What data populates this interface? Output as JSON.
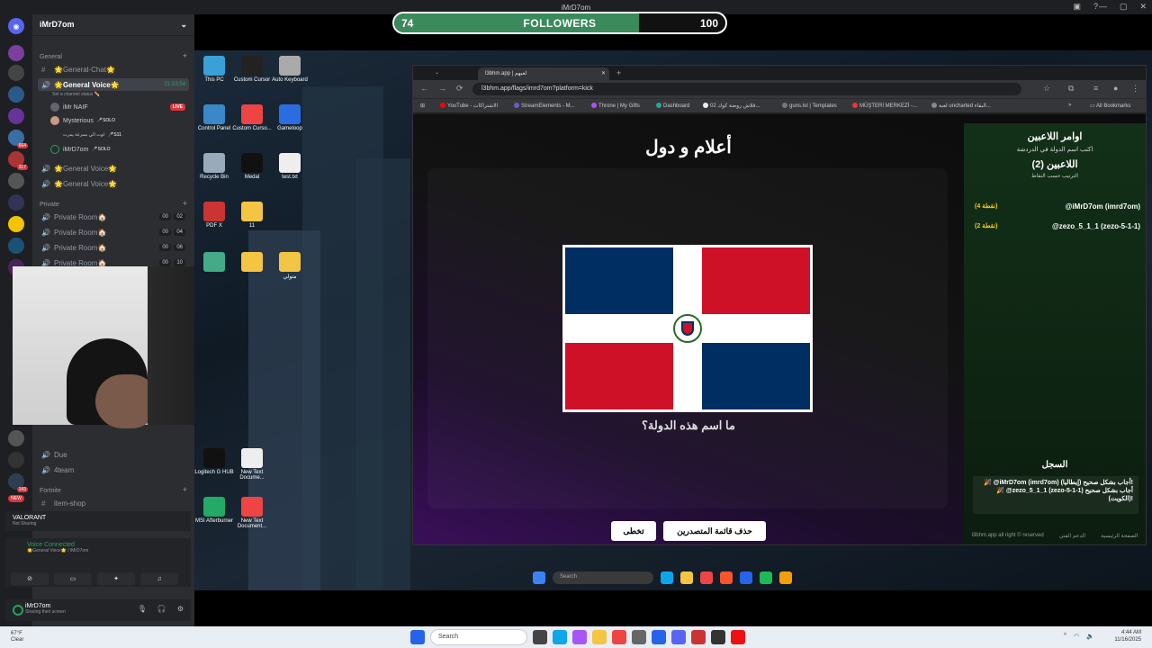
{
  "window": {
    "title": "iMrD7om"
  },
  "followers": {
    "current": "74",
    "label": "FOLLOWERS",
    "goal": "100",
    "progress": 0.74
  },
  "discord": {
    "server_name": "iMrD7om",
    "server_badges": [
      "664",
      "317",
      "24",
      "143",
      "NEW"
    ],
    "category_general": "General",
    "category_private": "Private",
    "category_fortnite": "Fortnite",
    "channels": {
      "general_chat": "🌟General-Chat🌟",
      "general_voice": "🌟General Voice🌟",
      "general_voice_time": "21:53:54",
      "set_status": "Set a channel status ✏️",
      "voice2": "🌟General Voice🌟",
      "voice3": "🌟General Voice🌟",
      "private1": "Private Room🏠",
      "private2": "Private Room🏠",
      "private3": "Private Room🏠",
      "private4": "Private Room🏠",
      "p1_a": "00",
      "p1_b": "02",
      "p2_a": "00",
      "p2_b": "04",
      "p3_a": "00",
      "p3_b": "06",
      "p4_a": "00",
      "p4_b": "10",
      "due": "Due",
      "team": "4team",
      "item_shop": "item-shop"
    },
    "voice_users": [
      {
        "name": "iMr NAIF",
        "tag": ""
      },
      {
        "name": "Mysterious",
        "tag": "🎤SOLO"
      },
      {
        "name": "لوت الي بسرعة يمرت",
        "tag": "🎤S11"
      },
      {
        "name": "iMrD7om",
        "tag": "🎤SOLO"
      }
    ],
    "live_badge": "LIVE",
    "activity": {
      "game": "VALORANT",
      "detail": "Not Sharing"
    },
    "voice_connected": {
      "title": "Voice Connected",
      "channel": "🌟General Voice🌟 / iMrD7om"
    },
    "user": {
      "name": "iMrD7om",
      "status": "Sharing their screen"
    }
  },
  "desktop_icons": [
    {
      "label": "This PC",
      "color": "#3aa0d8"
    },
    {
      "label": "Custom Cursor",
      "color": "#222"
    },
    {
      "label": "Auto Keyboard",
      "color": "#aaa"
    },
    {
      "label": "Control Panel",
      "color": "#3a88c8"
    },
    {
      "label": "Custom Curso...",
      "color": "#e44"
    },
    {
      "label": "Gameloop",
      "color": "#2a6de0"
    },
    {
      "label": "Recycle Bin",
      "color": "#9ab"
    },
    {
      "label": "Medal",
      "color": "#111"
    },
    {
      "label": "test.txt",
      "color": "#eee"
    },
    {
      "label": "PDF X",
      "color": "#c33"
    },
    {
      "label": "11",
      "color": "#f4c542"
    },
    {
      "label": "",
      "color": "#4a8"
    },
    {
      "label": "",
      "color": "#f4c542"
    },
    {
      "label": "متولي",
      "color": "#f4c542"
    },
    {
      "label": "Logitech G HUB",
      "color": "#111"
    },
    {
      "label": "New Text Docume...",
      "color": "#eee"
    },
    {
      "label": "MSI Afterburner",
      "color": "#2a6"
    },
    {
      "label": "New Text Document...",
      "color": "#e44"
    }
  ],
  "browser": {
    "tab_title": "l3bhm.app | لعبهم",
    "url": "l3bhm.app/flags/imrd7om?platform=kick",
    "bookmarks": [
      {
        "label": "YouTube - الاشتراكات",
        "color": "#f00"
      },
      {
        "label": "StreamElements - M...",
        "color": "#6a5acd"
      },
      {
        "label": "Throne | My Gifts",
        "color": "#a855f7"
      },
      {
        "label": "Dashboard",
        "color": "#2a9"
      },
      {
        "label": "02 قلاش روضة كوك...",
        "color": "#eee"
      },
      {
        "label": "guns.lol | Templates",
        "color": "#777"
      },
      {
        "label": "MÜŞTERİ MERKEZİ -...",
        "color": "#e33"
      },
      {
        "label": "لعبة uncharted البقاء...",
        "color": "#888"
      }
    ],
    "all_bookmarks": "All Bookmarks"
  },
  "game": {
    "title": "أعلام و دول",
    "question": "ما اسم هذه الدولة؟",
    "btn_skip": "تخطى",
    "btn_clear": "حذف قائمة المتصدرين",
    "panel_title": "اوامر اللاعبين",
    "panel_instruction": "اكتب اسم الدولة في الدردشة",
    "players_header": "اللاعبين (2)",
    "sort_note": "الترتيب حسب النقاط",
    "players": [
      {
        "name": "@iMrD7om (imrd7om)",
        "points": "(4 نقطة)"
      },
      {
        "name": "@zezo_5_1_1 (zezo-5-1-1)",
        "points": "(2 نقطة)"
      }
    ],
    "log_title": "السجل",
    "log_lines": [
      "🎉 @iMrD7om (imrd7om) أجاب بشكل صحيح (إيطاليا)!",
      "🎉 @zezo_5_1_1 (zezo-5-1-1) أجاب بشكل صحيح (الكويت)!"
    ],
    "footer": [
      "l3bhm.app all right © reserved",
      "الدعم الفني",
      "الصفحة الرئيسية"
    ]
  },
  "flag_colors": {
    "blue": "#002d62",
    "red": "#ce1126",
    "white": "#ffffff"
  },
  "inner_taskbar": {
    "search": "Search"
  },
  "taskbar": {
    "weather_temp": "67°F",
    "weather_desc": "Clear",
    "search": "Search",
    "time": "4:44 AM",
    "date": "11/16/2025"
  }
}
